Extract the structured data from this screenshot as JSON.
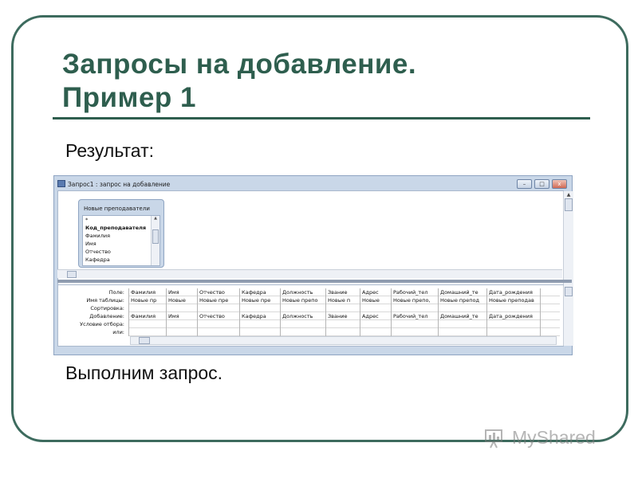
{
  "slide": {
    "title_line1": "Запросы на добавление.",
    "title_line2": "Пример 1",
    "result_label": "Результат:",
    "after_label": "Выполним запрос."
  },
  "window": {
    "title": "Запрос1 : запрос на добавление",
    "buttons": [
      "–",
      "□",
      "x"
    ]
  },
  "table_box": {
    "title": "Новые преподаватели",
    "fields": [
      "*",
      "Код_преподавателя",
      "Фамилия",
      "Имя",
      "Отчество",
      "Кафедра"
    ]
  },
  "grid": {
    "row_labels": [
      "Поле:",
      "Имя таблицы:",
      "Сортировка:",
      "Добавление:",
      "Условие отбора:",
      "или:"
    ],
    "columns": [
      {
        "field": "Фамилия",
        "table": "Новые пр",
        "append": "Фамилия"
      },
      {
        "field": "Имя",
        "table": "Новые",
        "append": "Имя"
      },
      {
        "field": "Отчество",
        "table": "Новые пре",
        "append": "Отчество"
      },
      {
        "field": "Кафедра",
        "table": "Новые пре",
        "append": "Кафедра"
      },
      {
        "field": "Должность",
        "table": "Новые препо",
        "append": "Должность"
      },
      {
        "field": "Звание",
        "table": "Новые п",
        "append": "Звание"
      },
      {
        "field": "Адрес",
        "table": "Новые",
        "append": "Адрес"
      },
      {
        "field": "Рабочий_тел",
        "table": "Новые препо,",
        "append": "Рабочий_тел"
      },
      {
        "field": "Домашний_те",
        "table": "Новые препод",
        "append": "Домашний_те"
      },
      {
        "field": "Дата_рождения",
        "table": "Новые преподав",
        "append": "Дата_рождения"
      },
      {
        "field": "",
        "table": "",
        "append": ""
      }
    ]
  },
  "watermark": {
    "text": "MyShared"
  },
  "colors": {
    "title": "#2e5e4e",
    "frame": "#3d6b5e",
    "window_bg": "#c9d7e8"
  }
}
